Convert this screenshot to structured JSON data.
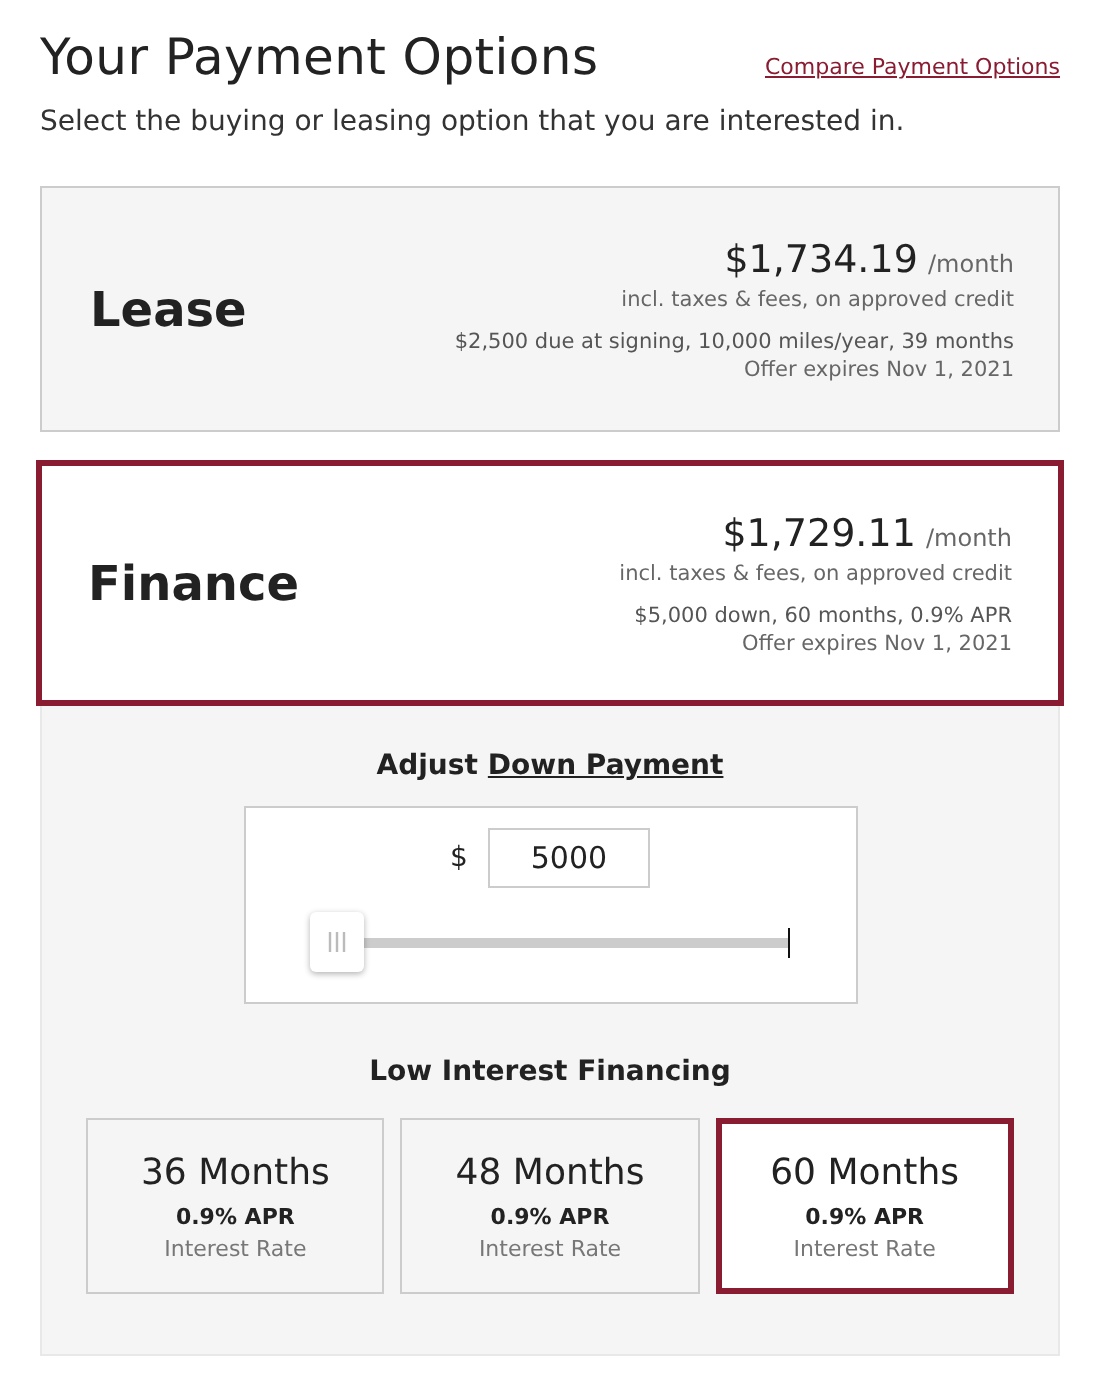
{
  "title": "Your Payment Options",
  "compare_link": "Compare Payment Options",
  "subtitle": "Select the buying or leasing option that you are interested in.",
  "options": [
    {
      "name": "Lease",
      "price": "$1,734.19",
      "per": "/month",
      "note": "incl. taxes & fees, on approved credit",
      "terms": "$2,500 due at signing, 10,000 miles/year, 39 months",
      "expires": "Offer expires Nov 1, 2021",
      "selected": false
    },
    {
      "name": "Finance",
      "price": "$1,729.11",
      "per": "/month",
      "note": "incl. taxes & fees, on approved credit",
      "terms": "$5,000 down, 60 months, 0.9% APR",
      "expires": "Offer expires Nov 1, 2021",
      "selected": true
    }
  ],
  "down_payment": {
    "label": "Adjust",
    "link": "Down Payment",
    "currency": "$",
    "value": "5000",
    "level": 0
  },
  "financing": {
    "title": "Low Interest Financing",
    "terms": [
      {
        "months": "36 Months",
        "apr": "0.9% APR",
        "label": "Interest Rate",
        "selected": false
      },
      {
        "months": "48 Months",
        "apr": "0.9% APR",
        "label": "Interest Rate",
        "selected": false
      },
      {
        "months": "60 Months",
        "apr": "0.9% APR",
        "label": "Interest Rate",
        "selected": true
      }
    ]
  }
}
